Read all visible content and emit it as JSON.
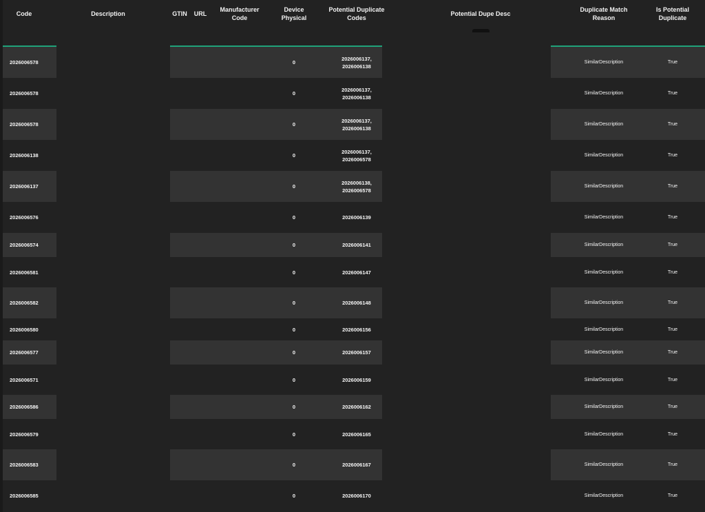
{
  "columns": {
    "code": "Code",
    "description": "Description",
    "gtin": "GTIN",
    "url": "URL",
    "manufacturer_code_1": "Manufacturer",
    "manufacturer_code_2": "Code",
    "device_physical_1": "Device",
    "device_physical_2": "Physical",
    "potential_duplicate_codes_1": "Potential Duplicate",
    "potential_duplicate_codes_2": "Codes",
    "potential_dupe_desc": "Potential Dupe Desc",
    "duplicate_match_reason_1": "Duplicate Match",
    "duplicate_match_reason_2": "Reason",
    "is_potential_duplicate_1": "Is Potential",
    "is_potential_duplicate_2": "Duplicate"
  },
  "colors": {
    "background": "#222222",
    "row_band": "#333333",
    "accent": "#1fa37a"
  },
  "rows": [
    {
      "code": "2026006578",
      "device_physical": "0",
      "dup_codes": [
        "2026006137,",
        "2026006138"
      ],
      "reason": "SimilarDescription",
      "is_dup": "True"
    },
    {
      "code": "2026006578",
      "device_physical": "0",
      "dup_codes": [
        "2026006137,",
        "2026006138"
      ],
      "reason": "SimilarDescription",
      "is_dup": "True"
    },
    {
      "code": "2026006578",
      "device_physical": "0",
      "dup_codes": [
        "2026006137,",
        "2026006138"
      ],
      "reason": "SimilarDescription",
      "is_dup": "True"
    },
    {
      "code": "2026006138",
      "device_physical": "0",
      "dup_codes": [
        "2026006137,",
        "2026006578"
      ],
      "reason": "SimilarDescription",
      "is_dup": "True"
    },
    {
      "code": "2026006137",
      "device_physical": "0",
      "dup_codes": [
        "2026006138,",
        "2026006578"
      ],
      "reason": "SimilarDescription",
      "is_dup": "True"
    },
    {
      "code": "2026006576",
      "device_physical": "0",
      "dup_codes": [
        "2026006139"
      ],
      "reason": "SimilarDescription",
      "is_dup": "True"
    },
    {
      "code": "2026006574",
      "device_physical": "0",
      "dup_codes": [
        "2026006141"
      ],
      "reason": "SimilarDescription",
      "is_dup": "True"
    },
    {
      "code": "2026006581",
      "device_physical": "0",
      "dup_codes": [
        "2026006147"
      ],
      "reason": "SimilarDescription",
      "is_dup": "True"
    },
    {
      "code": "2026006582",
      "device_physical": "0",
      "dup_codes": [
        "2026006148"
      ],
      "reason": "SimilarDescription",
      "is_dup": "True"
    },
    {
      "code": "2026006580",
      "device_physical": "0",
      "dup_codes": [
        "2026006156"
      ],
      "reason": "SimilarDescription",
      "is_dup": "True"
    },
    {
      "code": "2026006577",
      "device_physical": "0",
      "dup_codes": [
        "2026006157"
      ],
      "reason": "SimilarDescription",
      "is_dup": "True"
    },
    {
      "code": "2026006571",
      "device_physical": "0",
      "dup_codes": [
        "2026006159"
      ],
      "reason": "SimilarDescription",
      "is_dup": "True"
    },
    {
      "code": "2026006586",
      "device_physical": "0",
      "dup_codes": [
        "2026006162"
      ],
      "reason": "SimilarDescription",
      "is_dup": "True"
    },
    {
      "code": "2026006579",
      "device_physical": "0",
      "dup_codes": [
        "2026006165"
      ],
      "reason": "SimilarDescription",
      "is_dup": "True"
    },
    {
      "code": "2026006583",
      "device_physical": "0",
      "dup_codes": [
        "2026006167"
      ],
      "reason": "SimilarDescription",
      "is_dup": "True"
    },
    {
      "code": "2026006585",
      "device_physical": "0",
      "dup_codes": [
        "2026006170"
      ],
      "reason": "SimilarDescription",
      "is_dup": "True"
    }
  ]
}
